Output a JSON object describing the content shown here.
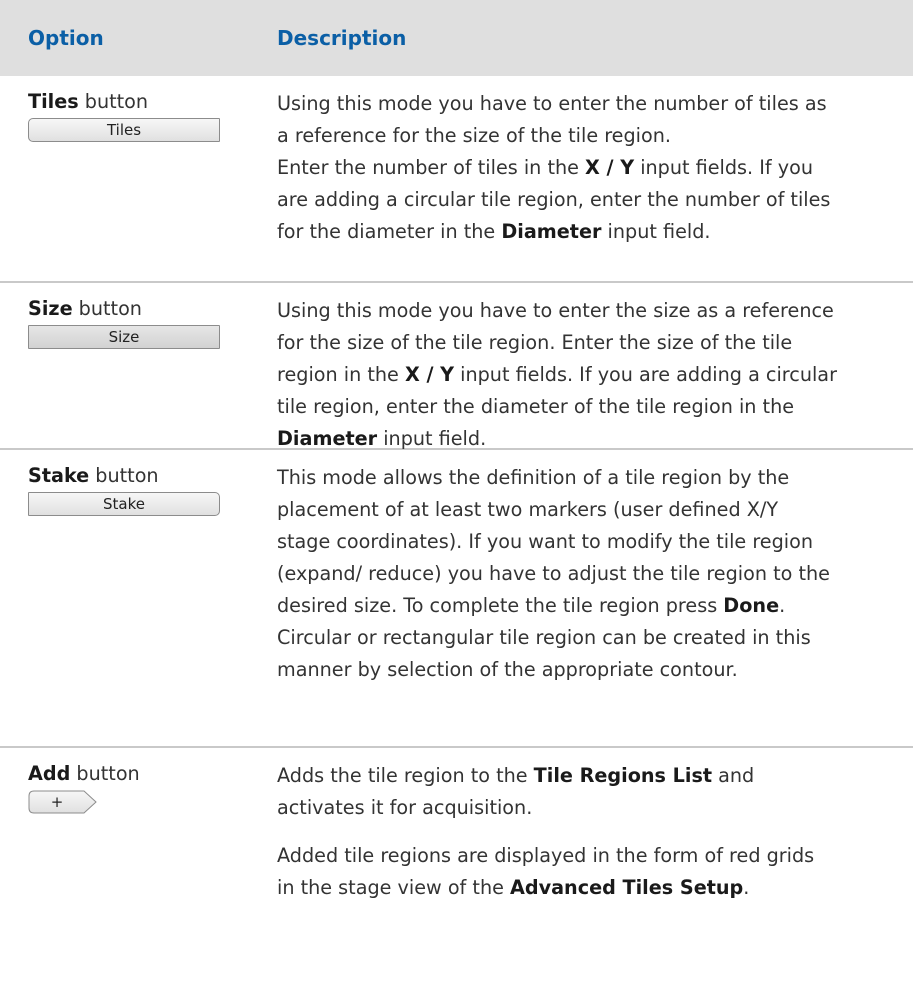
{
  "header": {
    "option": "Option",
    "description": "Description"
  },
  "rows": [
    {
      "option_bold": "Tiles",
      "option_suffix": " button",
      "button_label": "Tiles",
      "desc": [
        "Using this mode you have to enter the number of tiles as a reference for the size of the tile region.",
        "Enter the number of tiles in the ",
        "X / Y",
        " input fields. If you are adding a circular tile region, enter the number of tiles for the diameter in the ",
        "Diameter",
        " input field."
      ]
    },
    {
      "option_bold": "Size",
      "option_suffix": " button",
      "button_label": "Size",
      "desc": [
        "Using this mode you have to enter the size as a reference for the size of the tile region. Enter the size of the tile region in the ",
        "X / Y",
        " input fields. If you are adding a circular tile region, enter the diameter of the tile region in the ",
        "Diameter",
        " input field."
      ]
    },
    {
      "option_bold": "Stake",
      "option_suffix": " button",
      "button_label": "Stake",
      "desc": [
        "This mode allows the definition of a tile region by the placement of at least two markers (user defined X/Y stage coordinates). If you want to modify the tile region (expand/ reduce) you have to adjust the tile region to the desired size. To complete the tile region press ",
        "Done",
        ". Circular or rectangular tile region can be created in this manner by selection of the appropriate contour."
      ]
    },
    {
      "option_bold": "Add",
      "option_suffix": " button",
      "button_label": "+",
      "desc": [
        "Adds the tile region to the ",
        "Tile Regions List",
        " and activates it for acquisition.",
        "Added tile regions are displayed in the form of red grids in the stage view of the ",
        "Advanced Tiles Setup",
        "."
      ]
    }
  ]
}
